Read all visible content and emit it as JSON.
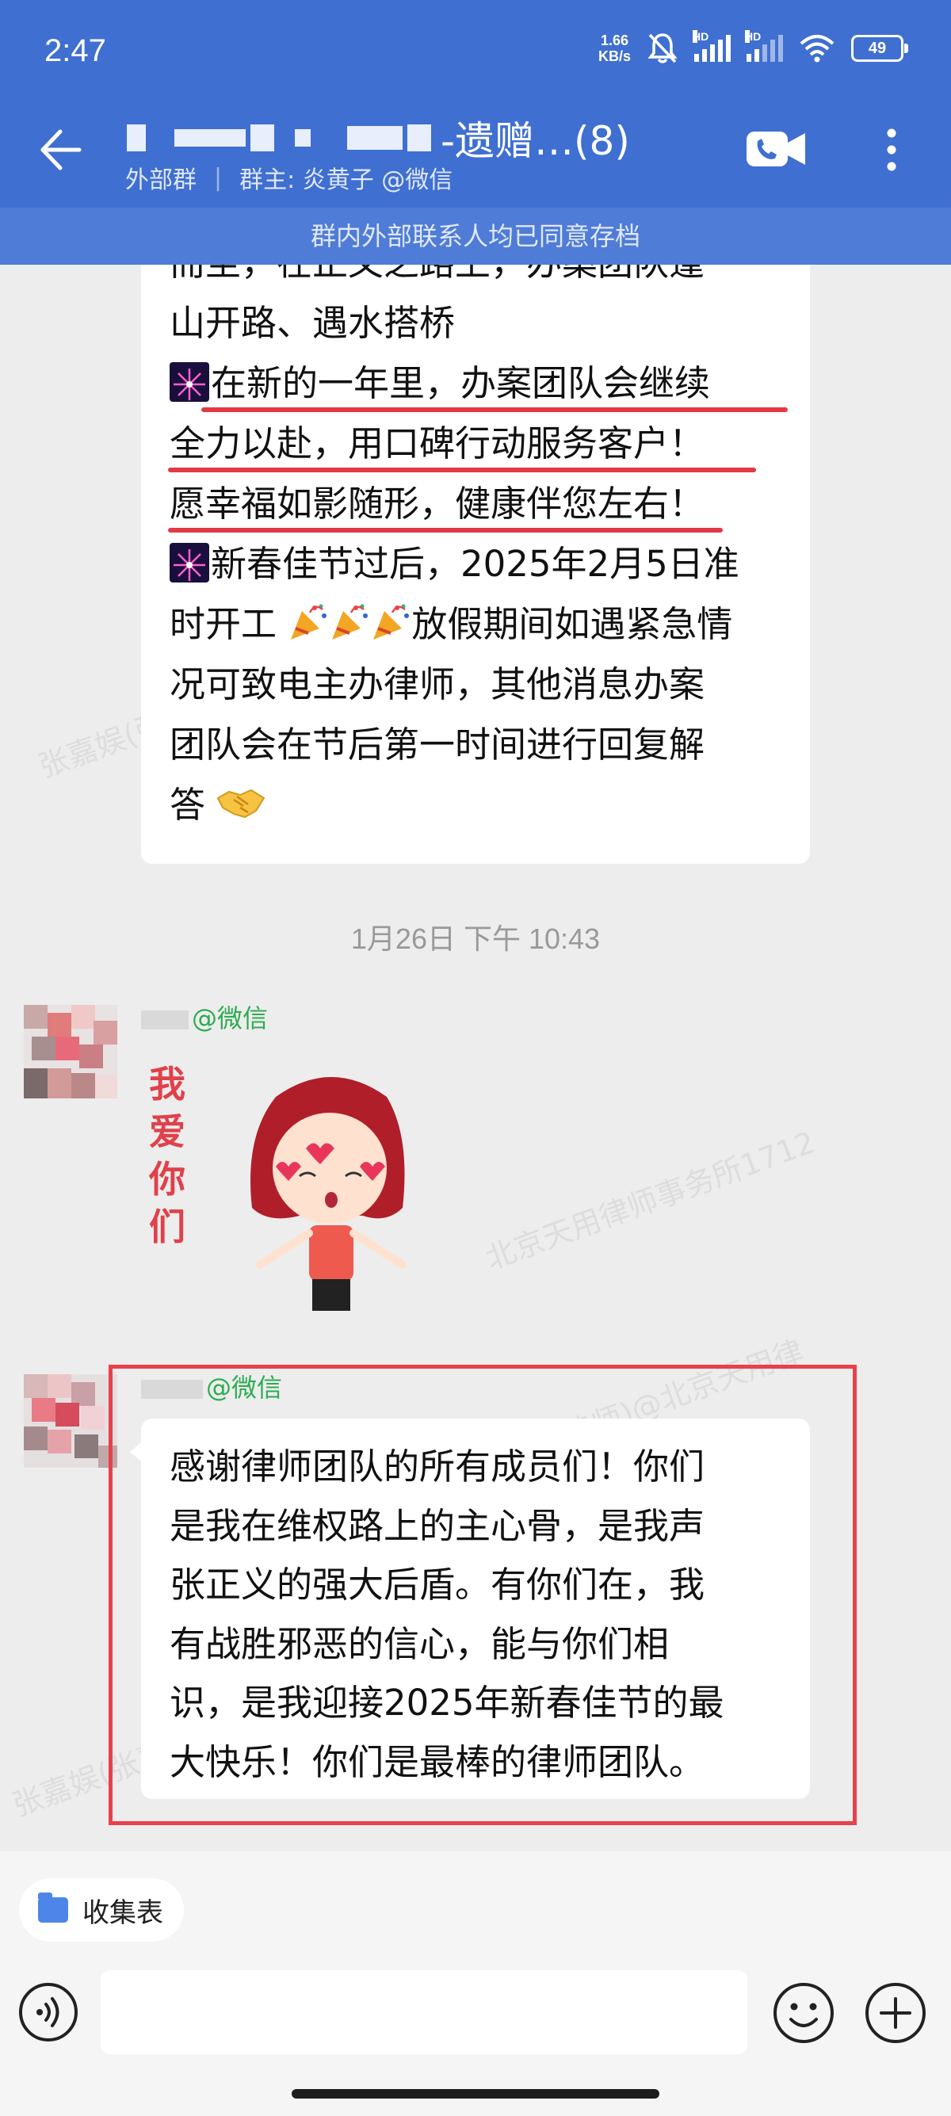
{
  "status_bar": {
    "time": "2:47",
    "net_speed_value": "1.66",
    "net_speed_unit": "KB/s",
    "signal_label_1": "HD",
    "signal_label_2": "HD",
    "battery": "49"
  },
  "header": {
    "title_suffix": "-遗赠…(8)",
    "tag": "外部群",
    "owner": "群主: 炎黄子 @微信",
    "icons": [
      "back-arrow-icon",
      "video-call-icon",
      "more-icon"
    ]
  },
  "archive_notice": "群内外部联系人均已同意存档",
  "messages": {
    "msg1_lines": [
      "而至，在正义之路上，办案团队逢",
      "山开路、遇水搭桥",
      "在新的一年里，办案团队会继续",
      "全力以赴，用口碑行动服务客户！",
      "愿幸福如影随形，健康伴您左右！",
      "新春佳节过后，2025年2月5日准",
      "时开工",
      "放假期间如遇紧急情",
      "况可致电主办律师，其他消息办案",
      "团队会在节后第一时间进行回复解",
      "答"
    ],
    "timestamp": "1月26日  下午 10:43",
    "sender1": "@微信",
    "sticker_text": [
      "我",
      "爱",
      "你",
      "们"
    ],
    "sender2": "@微信",
    "msg2_lines": [
      "感谢律师团队的所有成员们！你们",
      "是我在维权路上的主心骨，是我声",
      "张正义的强大后盾。有你们在，我",
      "有战胜邪恶的信心，能与你们相",
      "识，是我迎接2025年新春佳节的最",
      "大快乐！你们是最棒的律师团队。"
    ]
  },
  "watermarks": [
    "张嘉娱(张嘉娱 | 合伙人律师)@北京天用律师事务所1712",
    "北京天用律师事务所1712",
    "张嘉娱(张嘉娱 | 合伙人律师)@北京天用律",
    "张嘉娱(张嘉"
  ],
  "composer": {
    "quick_chip": "收集表"
  }
}
